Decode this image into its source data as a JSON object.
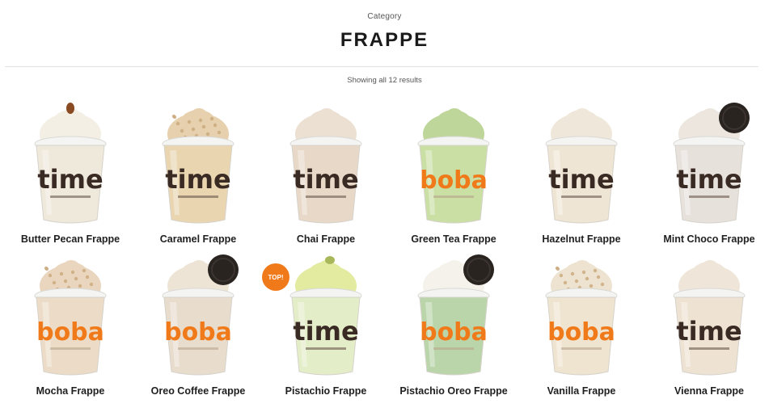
{
  "header": {
    "breadcrumb": "Category",
    "title": "FRAPPE"
  },
  "results": "Showing all 12 results",
  "products": [
    {
      "name": "Butter Pecan Frappe",
      "drink": "#efe9dc",
      "cream": "#f3efe4",
      "brand": "time",
      "topping": "pecan"
    },
    {
      "name": "Caramel Frappe",
      "drink": "#e9d5b0",
      "cream": "#e6d0ad",
      "brand": "time",
      "topping": "crumble"
    },
    {
      "name": "Chai Frappe",
      "drink": "#e8d8c8",
      "cream": "#ece0d2",
      "brand": "time",
      "topping": "none"
    },
    {
      "name": "Green Tea Frappe",
      "drink": "#c9dfa4",
      "cream": "#bfd69a",
      "brand": "boba",
      "topping": "none"
    },
    {
      "name": "Hazelnut Frappe",
      "drink": "#efe5d4",
      "cream": "#efe7da",
      "brand": "time",
      "topping": "none"
    },
    {
      "name": "Mint Choco Frappe",
      "drink": "#e7e1dc",
      "cream": "#ece6df",
      "brand": "time",
      "topping": "oreo"
    },
    {
      "name": "Mocha Frappe",
      "drink": "#ecdcc7",
      "cream": "#ead6bf",
      "brand": "boba",
      "topping": "crumble"
    },
    {
      "name": "Oreo Coffee Frappe",
      "drink": "#e8dccd",
      "cream": "#eee4d6",
      "brand": "boba",
      "topping": "oreo"
    },
    {
      "name": "Pistachio Frappe",
      "drink": "#e3edc7",
      "cream": "#e3eba0",
      "brand": "time",
      "topping": "pistachio",
      "badge": "TOP!"
    },
    {
      "name": "Pistachio Oreo Frappe",
      "drink": "#b9d5a9",
      "cream": "#f4f2ea",
      "brand": "boba",
      "topping": "oreo"
    },
    {
      "name": "Vanilla Frappe",
      "drink": "#efe4cf",
      "cream": "#ede3d0",
      "brand": "boba",
      "topping": "crumble"
    },
    {
      "name": "Vienna Frappe",
      "drink": "#eee2d2",
      "cream": "#efe6d9",
      "brand": "time",
      "topping": "none"
    }
  ],
  "colors": {
    "brand_orange": "#f07a1a",
    "brand_dark": "#3a2a24"
  },
  "logo_text": {
    "time": "time",
    "boba": "boba"
  }
}
